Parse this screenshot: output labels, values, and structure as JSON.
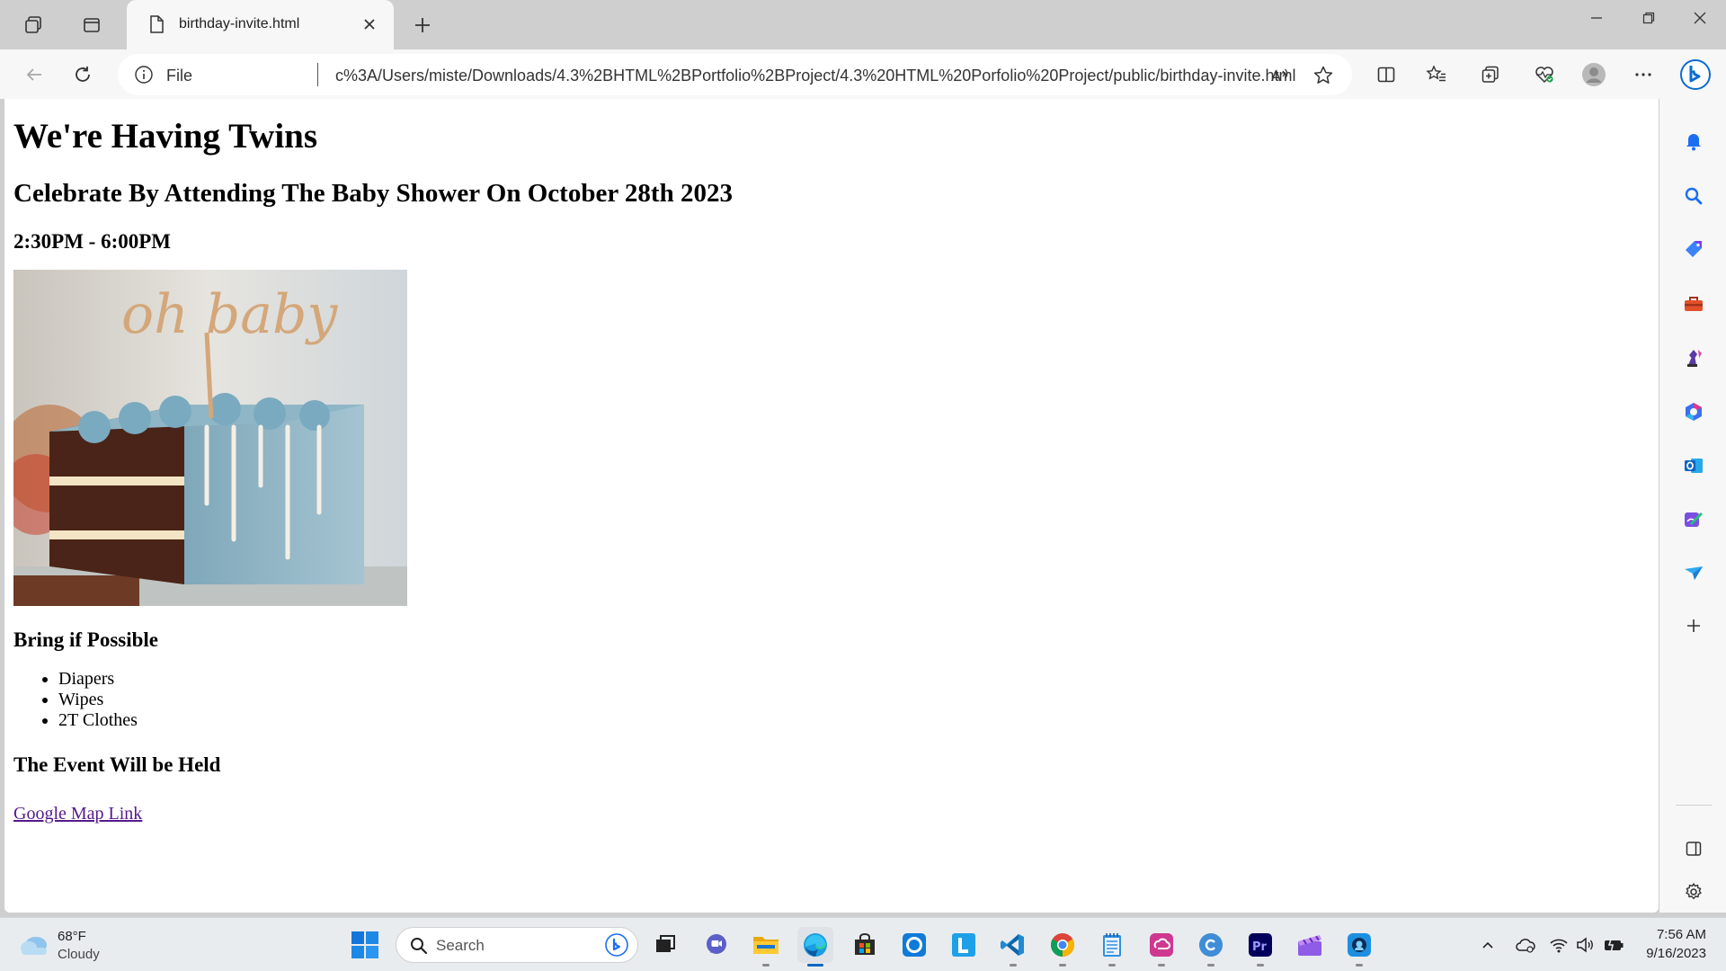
{
  "browser": {
    "tab": {
      "title": "birthday-invite.html"
    },
    "address": {
      "scheme": "File",
      "url": "c%3A/Users/miste/Downloads/4.3%2BHTML%2BPortfolio%2BProject/4.3%20HTML%20Porfolio%20Project/public/birthday-invite.html"
    },
    "read_aloud_label": "Aͅ"
  },
  "page": {
    "heading": "We're Having Twins",
    "subheading": "Celebrate By Attending The Baby Shower On October 28th 2023",
    "time": "2:30PM - 6:00PM",
    "image_topper_text": "oh baby",
    "bring_heading": "Bring if Possible",
    "bring_items": [
      "Diapers",
      "Wipes",
      "2T Clothes"
    ],
    "event_heading": "The Event Will be Held",
    "map_link": "Google Map Link"
  },
  "taskbar": {
    "weather": {
      "temp": "68°F",
      "condition": "Cloudy"
    },
    "search_placeholder": "Search",
    "clock": {
      "time": "7:56 AM",
      "date": "9/16/2023"
    }
  },
  "colors": {
    "edge_blue": "#0067c0",
    "link_visited": "#551a8b",
    "cake_frosting": "#8fb6c6"
  }
}
